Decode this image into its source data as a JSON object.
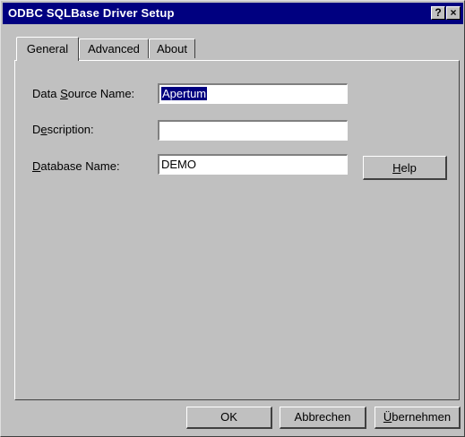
{
  "window": {
    "title": "ODBC SQLBase Driver Setup",
    "help_glyph": "?",
    "close_glyph": "×"
  },
  "tabs": [
    {
      "label": "General",
      "active": true
    },
    {
      "label": "Advanced",
      "active": false
    },
    {
      "label": "About",
      "active": false
    }
  ],
  "form": {
    "data_source_name": {
      "label_pre": "Data ",
      "label_mnemonic": "S",
      "label_post": "ource Name:",
      "value": "Apertum",
      "selected": true
    },
    "description": {
      "label_pre": "D",
      "label_mnemonic": "e",
      "label_post": "scription:",
      "value": ""
    },
    "database_name": {
      "label_pre": "",
      "label_mnemonic": "D",
      "label_post": "atabase Name:",
      "value": "DEMO"
    }
  },
  "buttons": {
    "help": {
      "pre": "",
      "mnemonic": "H",
      "post": "elp"
    },
    "ok": {
      "label": "OK"
    },
    "cancel": {
      "label": "Abbrechen"
    },
    "apply": {
      "pre": "",
      "mnemonic": "Ü",
      "post": "bernehmen"
    }
  },
  "colors": {
    "titlebar": "#000080",
    "face": "#c0c0c0",
    "selection": "#000080"
  }
}
